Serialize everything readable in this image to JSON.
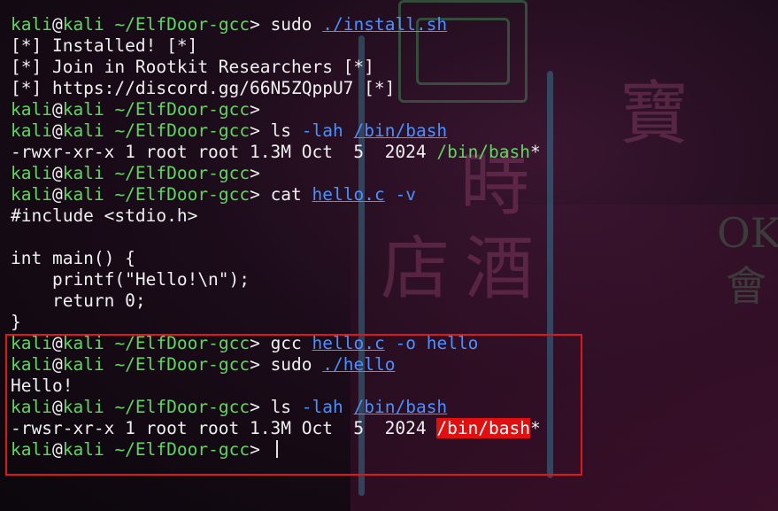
{
  "prompt": {
    "user": "kali",
    "at": "@",
    "host": "kali",
    "dir": "~/ElfDoor-gcc",
    "symbol": ">"
  },
  "lines": [
    {
      "type": "cmd",
      "cmd": "sudo",
      "args": [
        {
          "text": "./install.sh",
          "style": "path-ul"
        }
      ]
    },
    {
      "type": "out",
      "text": "[*] Installed! [*]"
    },
    {
      "type": "out",
      "text": "[*] Join in Rootkit Researchers [*]"
    },
    {
      "type": "out",
      "text": "[*] https://discord.gg/66N5ZQppU7 [*]"
    },
    {
      "type": "cmd",
      "cmd": "",
      "args": []
    },
    {
      "type": "cmd",
      "cmd": "ls",
      "args": [
        {
          "text": "-lah",
          "style": "flag"
        },
        {
          "text": "/bin/bash",
          "style": "path-ul"
        }
      ]
    },
    {
      "type": "ls",
      "text": "-rwxr-xr-x 1 root root 1.3M Oct  5  2024 ",
      "file": "/bin/bash",
      "file_style": "green",
      "suffix": "*"
    },
    {
      "type": "cmd",
      "cmd": "",
      "args": []
    },
    {
      "type": "cmd",
      "cmd": "cat",
      "args": [
        {
          "text": "hello.c",
          "style": "path-ul"
        },
        {
          "text": "-v",
          "style": "flag"
        }
      ]
    },
    {
      "type": "out",
      "text": "#include <stdio.h>"
    },
    {
      "type": "out",
      "text": ""
    },
    {
      "type": "out",
      "text": "int main() {"
    },
    {
      "type": "out",
      "text": "    printf(\"Hello!\\n\");"
    },
    {
      "type": "out",
      "text": "    return 0;"
    },
    {
      "type": "out",
      "text": "}"
    },
    {
      "type": "cmd",
      "cmd": "gcc",
      "args": [
        {
          "text": "hello.c",
          "style": "path-ul"
        },
        {
          "text": "-o",
          "style": "flag"
        },
        {
          "text": "hello",
          "style": "flag"
        }
      ]
    },
    {
      "type": "cmd",
      "cmd": "sudo",
      "args": [
        {
          "text": "./hello",
          "style": "path-ul"
        }
      ]
    },
    {
      "type": "out",
      "text": "Hello!"
    },
    {
      "type": "cmd",
      "cmd": "ls",
      "args": [
        {
          "text": "-lah",
          "style": "flag"
        },
        {
          "text": "/bin/bash",
          "style": "path-ul"
        }
      ]
    },
    {
      "type": "ls",
      "text": "-rwsr-xr-x 1 root root 1.3M Oct  5  2024 ",
      "file": "/bin/bash",
      "file_style": "red",
      "suffix": "*"
    },
    {
      "type": "cmd",
      "cmd": "",
      "args": [],
      "cursor": true
    }
  ],
  "colors": {
    "user": "#5fd75f",
    "path": "#4a90ff",
    "highlight": "#e01010",
    "box": "#e01818"
  }
}
